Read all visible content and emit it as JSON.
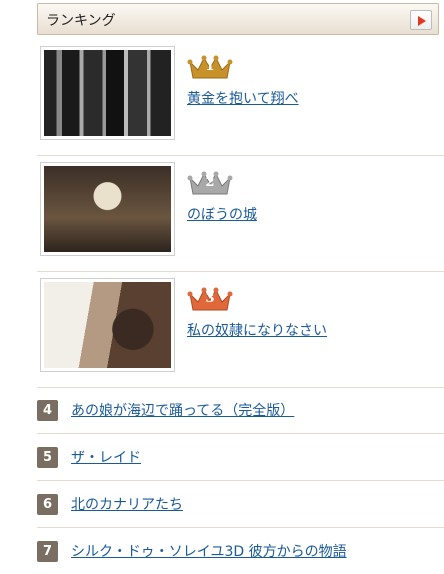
{
  "header": {
    "title": "ランキング"
  },
  "top": [
    {
      "rank": "1",
      "title": "黄金を抱いて翔べ",
      "crown_color": "#c8922a"
    },
    {
      "rank": "2",
      "title": "のぼうの城",
      "crown_color": "#9a9a9a"
    },
    {
      "rank": "3",
      "title": "私の奴隷になりなさい",
      "crown_color": "#e0683a"
    }
  ],
  "list": [
    {
      "rank": "4",
      "title": "あの娘が海辺で踊ってる（完全版）"
    },
    {
      "rank": "5",
      "title": "ザ・レイド"
    },
    {
      "rank": "6",
      "title": "北のカナリアたち"
    },
    {
      "rank": "7",
      "title": "シルク・ドゥ・ソレイユ3D 彼方からの物語"
    }
  ]
}
